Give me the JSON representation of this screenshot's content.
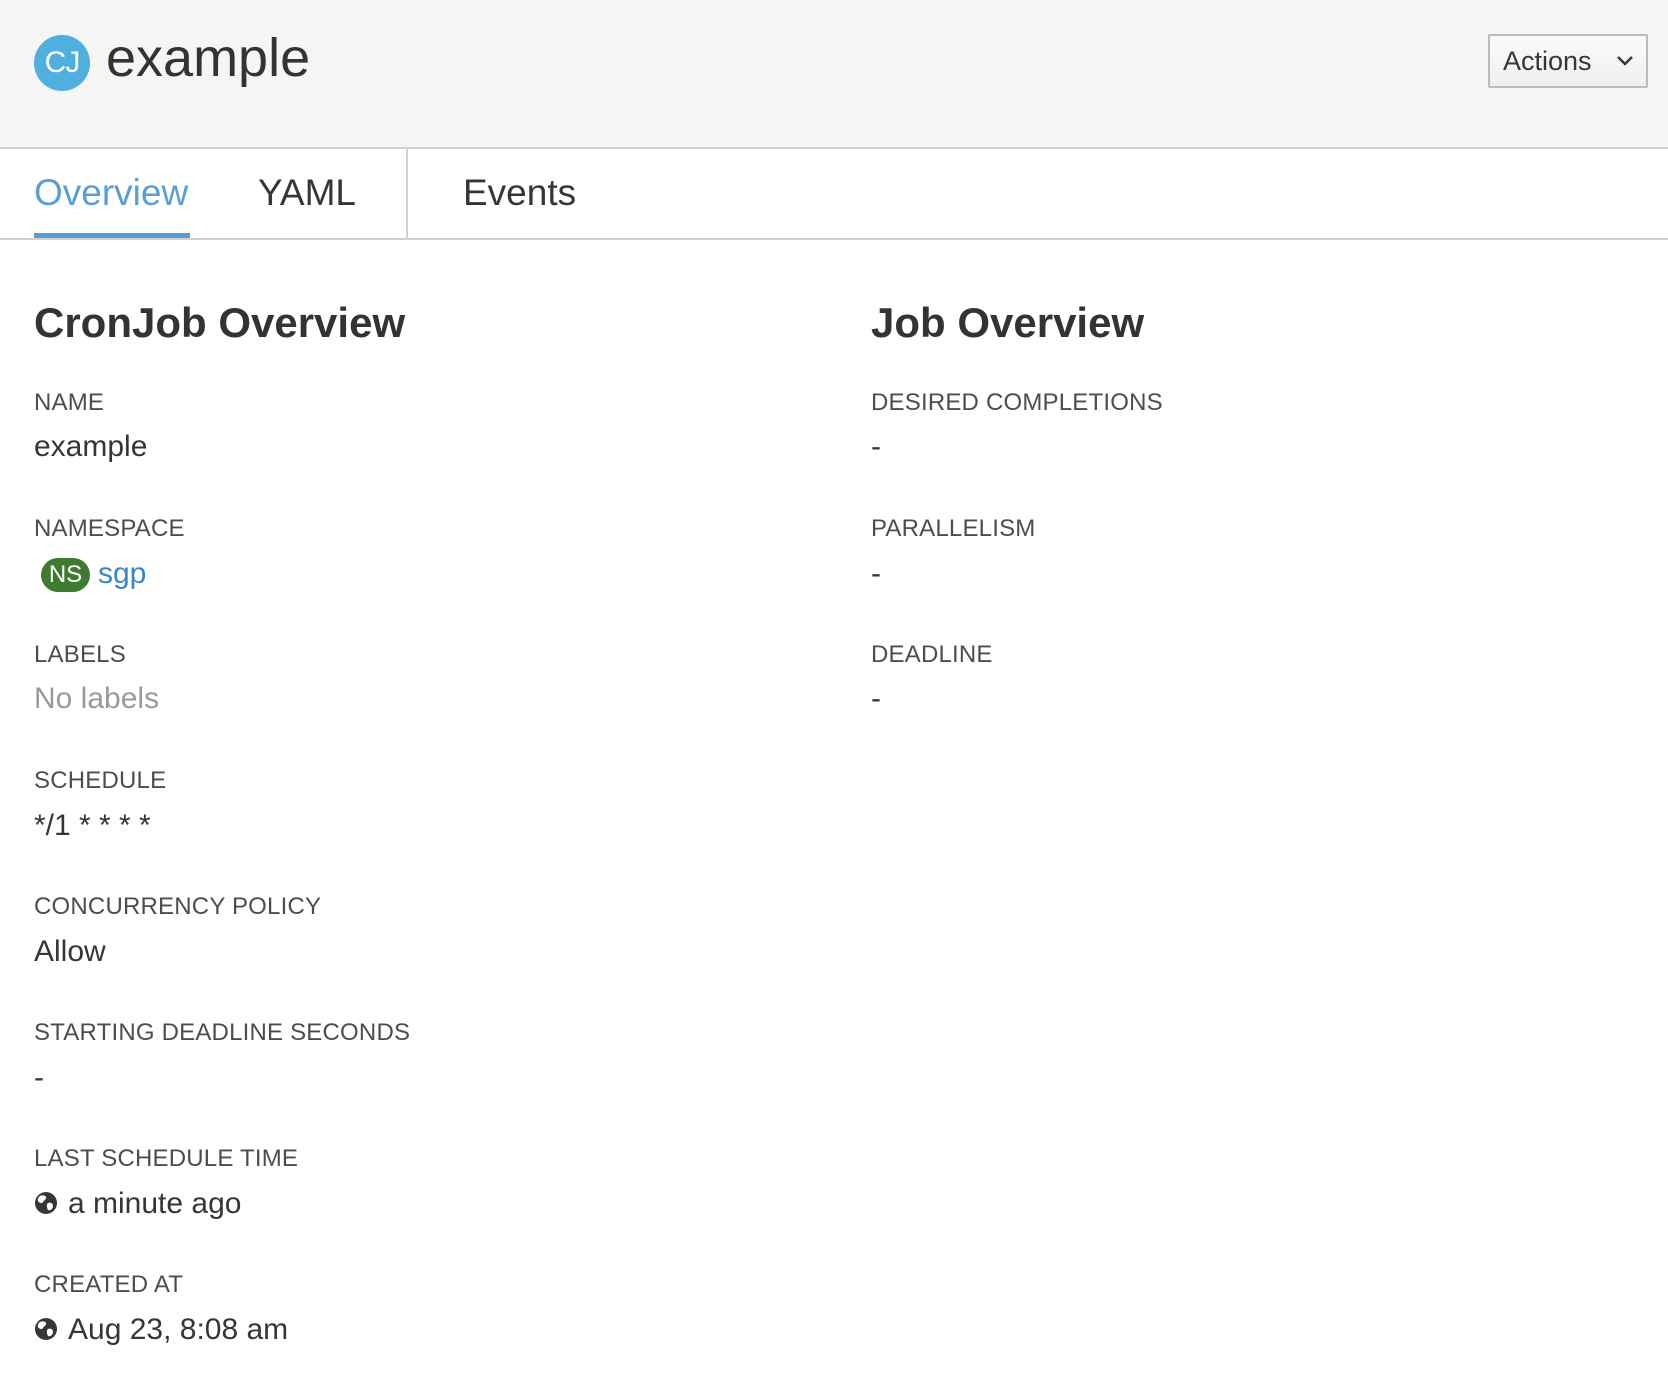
{
  "header": {
    "icon_label": "CJ",
    "title": "example",
    "actions_label": "Actions"
  },
  "tabs": [
    {
      "label": "Overview",
      "active": true
    },
    {
      "label": "YAML",
      "active": false
    },
    {
      "label": "Events",
      "active": false
    }
  ],
  "cronjob_overview": {
    "title": "CronJob Overview",
    "name": {
      "label": "NAME",
      "value": "example"
    },
    "namespace": {
      "label": "NAMESPACE",
      "badge": "NS",
      "value": "sgp"
    },
    "labels": {
      "label": "LABELS",
      "value": "No labels"
    },
    "schedule": {
      "label": "SCHEDULE",
      "value": "*/1 * * * *"
    },
    "concurrency_policy": {
      "label": "CONCURRENCY POLICY",
      "value": "Allow"
    },
    "starting_deadline_seconds": {
      "label": "STARTING DEADLINE SECONDS",
      "value": "-"
    },
    "last_schedule_time": {
      "label": "LAST SCHEDULE TIME",
      "icon": "globe-icon",
      "value": "a minute ago"
    },
    "created_at": {
      "label": "CREATED AT",
      "icon": "globe-icon",
      "value": "Aug 23, 8:08 am"
    }
  },
  "job_overview": {
    "title": "Job Overview",
    "desired_completions": {
      "label": "DESIRED COMPLETIONS",
      "value": "-"
    },
    "parallelism": {
      "label": "PARALLELISM",
      "value": "-"
    },
    "deadline": {
      "label": "DEADLINE",
      "value": "-"
    }
  },
  "colors": {
    "accent": "#5a9fd4",
    "resource_icon": "#4fb0e0",
    "namespace_badge": "#3e7b2e",
    "link": "#3a87c8",
    "header_background": "#f5f5f5"
  }
}
